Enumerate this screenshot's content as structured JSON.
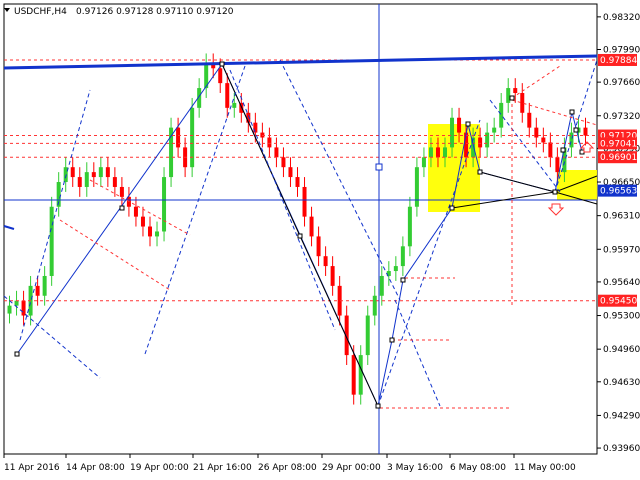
{
  "header": {
    "symbol": "USDCHF,H4",
    "ohlc": "0.97126 0.97128 0.97110 0.97120"
  },
  "colors": {
    "background": "#ffffff",
    "bull": "#33cc33",
    "bear": "#ff0000",
    "dashed": "#ff3333",
    "blue": "#1133cc",
    "price_label_red": "#ff2222",
    "price_label_blue": "#1133cc",
    "highlight": "#ffff00"
  },
  "chart_data": {
    "type": "candlestick",
    "symbol": "USDCHF",
    "timeframe": "H4",
    "x_tick_labels": [
      "11 Apr 2016",
      "14 Apr 08:00",
      "19 Apr 00:00",
      "21 Apr 16:00",
      "26 Apr 08:00",
      "29 Apr 00:00",
      "3 May 16:00",
      "6 May 08:00",
      "11 May 00:00"
    ],
    "y_tick_labels": [
      "0.98320",
      "0.97990",
      "0.97660",
      "0.97320",
      "0.96990",
      "0.96650",
      "0.96310",
      "0.95970",
      "0.95640",
      "0.95300",
      "0.94960",
      "0.94630",
      "0.94290",
      "0.93960"
    ],
    "ylim": [
      0.939,
      0.9845
    ],
    "price_markers": [
      {
        "label": "0.97884",
        "value": 0.97884,
        "style": "red"
      },
      {
        "label": "0.97120",
        "value": 0.9712,
        "style": "red"
      },
      {
        "label": "0.97041",
        "value": 0.97041,
        "style": "red"
      },
      {
        "label": "0.96901",
        "value": 0.96901,
        "style": "red"
      },
      {
        "label": "0.96563",
        "value": 0.96563,
        "style": "blue"
      },
      {
        "label": "0.95450",
        "value": 0.9545,
        "style": "red"
      }
    ],
    "close_path": [
      [
        0,
        0.954
      ],
      [
        1,
        0.9545
      ],
      [
        2,
        0.953
      ],
      [
        3,
        0.956
      ],
      [
        4,
        0.955
      ],
      [
        5,
        0.957
      ],
      [
        6,
        0.964
      ],
      [
        7,
        0.9665
      ],
      [
        8,
        0.968
      ],
      [
        9,
        0.967
      ],
      [
        10,
        0.966
      ],
      [
        11,
        0.9675
      ],
      [
        12,
        0.967
      ],
      [
        13,
        0.968
      ],
      [
        14,
        0.967
      ],
      [
        15,
        0.966
      ],
      [
        16,
        0.965
      ],
      [
        17,
        0.964
      ],
      [
        18,
        0.963
      ],
      [
        19,
        0.962
      ],
      [
        20,
        0.961
      ],
      [
        21,
        0.9615
      ],
      [
        22,
        0.967
      ],
      [
        23,
        0.972
      ],
      [
        24,
        0.97
      ],
      [
        25,
        0.968
      ],
      [
        26,
        0.974
      ],
      [
        27,
        0.976
      ],
      [
        28,
        0.9785
      ],
      [
        29,
        0.978
      ],
      [
        30,
        0.9765
      ],
      [
        31,
        0.974
      ],
      [
        32,
        0.9745
      ],
      [
        33,
        0.9735
      ],
      [
        34,
        0.9725
      ],
      [
        35,
        0.9715
      ],
      [
        36,
        0.971
      ],
      [
        37,
        0.97
      ],
      [
        38,
        0.969
      ],
      [
        39,
        0.968
      ],
      [
        40,
        0.967
      ],
      [
        41,
        0.966
      ],
      [
        42,
        0.963
      ],
      [
        43,
        0.961
      ],
      [
        44,
        0.959
      ],
      [
        45,
        0.958
      ],
      [
        46,
        0.956
      ],
      [
        47,
        0.953
      ],
      [
        48,
        0.949
      ],
      [
        49,
        0.945
      ],
      [
        50,
        0.949
      ],
      [
        51,
        0.953
      ],
      [
        52,
        0.955
      ],
      [
        53,
        0.957
      ],
      [
        54,
        0.9575
      ],
      [
        55,
        0.958
      ],
      [
        56,
        0.96
      ],
      [
        57,
        0.964
      ],
      [
        58,
        0.968
      ],
      [
        59,
        0.969
      ],
      [
        60,
        0.97
      ],
      [
        61,
        0.969
      ],
      [
        62,
        0.97
      ],
      [
        63,
        0.973
      ],
      [
        64,
        0.9715
      ],
      [
        65,
        0.969
      ],
      [
        66,
        0.971
      ],
      [
        67,
        0.97
      ],
      [
        68,
        0.9715
      ],
      [
        69,
        0.972
      ],
      [
        70,
        0.9745
      ],
      [
        71,
        0.976
      ],
      [
        72,
        0.9755
      ],
      [
        73,
        0.9735
      ],
      [
        74,
        0.972
      ],
      [
        75,
        0.971
      ],
      [
        76,
        0.9705
      ],
      [
        77,
        0.969
      ],
      [
        78,
        0.9675
      ],
      [
        79,
        0.97
      ],
      [
        80,
        0.9715
      ],
      [
        81,
        0.972
      ],
      [
        82,
        0.9712
      ]
    ],
    "price_label_positions": {
      "0.97884": 0.97884,
      "0.97120": 0.9712
    }
  }
}
